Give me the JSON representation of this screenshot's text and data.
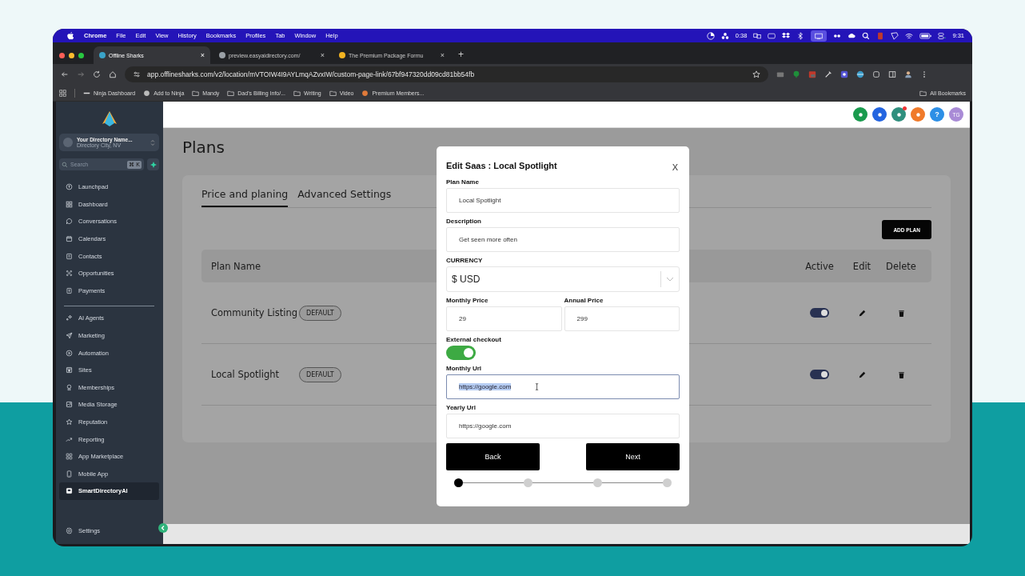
{
  "menu_bar": {
    "app": "Chrome",
    "menus": [
      "File",
      "Edit",
      "View",
      "History",
      "Bookmarks",
      "Profiles",
      "Tab",
      "Window",
      "Help"
    ],
    "timer": "0:38",
    "clock": "9:31"
  },
  "browser": {
    "tabs": [
      {
        "title": "Offline Sharks",
        "selected": true,
        "close": "×"
      },
      {
        "title": "preview.easyaidirectory.com/",
        "selected": false,
        "close": "×"
      },
      {
        "title": "The Premium Package Formu",
        "selected": false,
        "close": "×"
      }
    ],
    "new_tab": "+",
    "url": "app.offlinesharks.com/v2/location/mVTOIW4I9AYLmqAZvxIW/custom-page-link/67bf947320dd09cd81bb54fb",
    "bookmarks": [
      {
        "label": "Ninja Dashboard",
        "kind": "link"
      },
      {
        "label": "Add to Ninja",
        "kind": "web"
      },
      {
        "label": "Mandy",
        "kind": "folder"
      },
      {
        "label": "Dad's Billing Info/...",
        "kind": "folder"
      },
      {
        "label": "Writing",
        "kind": "folder"
      },
      {
        "label": "Video",
        "kind": "folder"
      },
      {
        "label": "Premium Members...",
        "kind": "app"
      }
    ],
    "all_bookmarks": "All Bookmarks"
  },
  "sidebar": {
    "account": {
      "name": "Your Directory Name...",
      "location": "Directory City, NV"
    },
    "search": {
      "placeholder": "Search",
      "shortcut": "⌘ K"
    },
    "nav_top": [
      {
        "label": "Launchpad",
        "selected": false
      },
      {
        "label": "Dashboard",
        "selected": false
      },
      {
        "label": "Conversations",
        "selected": false
      },
      {
        "label": "Calendars",
        "selected": false
      },
      {
        "label": "Contacts",
        "selected": false
      },
      {
        "label": "Opportunities",
        "selected": false
      },
      {
        "label": "Payments",
        "selected": false
      }
    ],
    "nav_main": [
      {
        "label": "AI Agents",
        "selected": false
      },
      {
        "label": "Marketing",
        "selected": false
      },
      {
        "label": "Automation",
        "selected": false
      },
      {
        "label": "Sites",
        "selected": false
      },
      {
        "label": "Memberships",
        "selected": false
      },
      {
        "label": "Media Storage",
        "selected": false
      },
      {
        "label": "Reputation",
        "selected": false
      },
      {
        "label": "Reporting",
        "selected": false
      },
      {
        "label": "App Marketplace",
        "selected": false
      },
      {
        "label": "Mobile App",
        "selected": false
      },
      {
        "label": "SmartDirectoryAI",
        "selected": true
      }
    ],
    "settings": "Settings"
  },
  "header": {
    "avatar": "TG",
    "help": "?"
  },
  "page": {
    "title": "Plans",
    "tabs": [
      {
        "label": "Price and planing",
        "selected": true
      },
      {
        "label": "Advanced Settings",
        "selected": false
      }
    ],
    "add_button": "ADD PLAN",
    "columns": [
      "Plan Name",
      "Active",
      "Edit",
      "Delete"
    ],
    "rows": [
      {
        "name": "Community Listing",
        "badge": "DEFAULT",
        "active": true
      },
      {
        "name": "Local Spotlight",
        "badge": "DEFAULT",
        "active": true
      }
    ]
  },
  "modal": {
    "title": "Edit Saas : Local Spotlight",
    "close": "X",
    "plan_name": {
      "label": "Plan Name",
      "value": "Local Spotlight"
    },
    "description": {
      "label": "Description",
      "value": "Get seen more often"
    },
    "currency": {
      "label": "CURRENCY",
      "value": "$ USD"
    },
    "monthly_price": {
      "label": "Monthly Price",
      "value": "29"
    },
    "annual_price": {
      "label": "Annual Price",
      "value": "299"
    },
    "external_checkout": {
      "label": "External checkout",
      "on": true
    },
    "monthly_url": {
      "label": "Monthly Url",
      "value": "https://google.com",
      "focused": true
    },
    "yearly_url": {
      "label": "Yearly Url",
      "value": "https://google.com",
      "focused": false
    },
    "back": "Back",
    "next": "Next",
    "steps": [
      {
        "selected": true
      },
      {
        "selected": false
      },
      {
        "selected": false
      },
      {
        "selected": false
      }
    ]
  }
}
